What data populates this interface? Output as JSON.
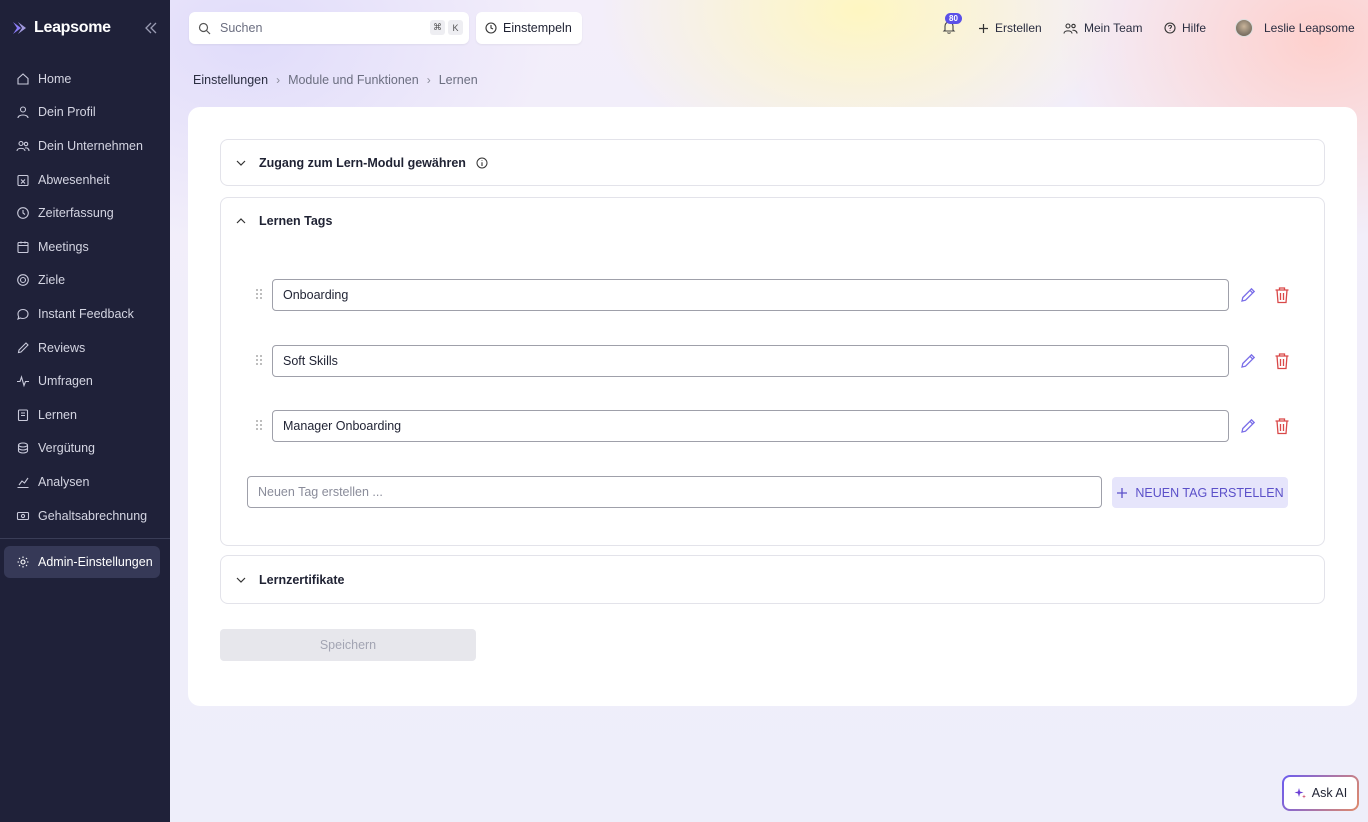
{
  "app": {
    "name": "Leapsome"
  },
  "sidebar": {
    "items": [
      {
        "label": "Home",
        "icon": "home-icon"
      },
      {
        "label": "Dein Profil",
        "icon": "user-icon"
      },
      {
        "label": "Dein Unternehmen",
        "icon": "users-icon"
      },
      {
        "label": "Abwesenheit",
        "icon": "calendar-x-icon"
      },
      {
        "label": "Zeiterfassung",
        "icon": "clock-icon"
      },
      {
        "label": "Meetings",
        "icon": "calendar-icon"
      },
      {
        "label": "Ziele",
        "icon": "target-icon"
      },
      {
        "label": "Instant Feedback",
        "icon": "chat-icon"
      },
      {
        "label": "Reviews",
        "icon": "pencil-icon"
      },
      {
        "label": "Umfragen",
        "icon": "pulse-icon"
      },
      {
        "label": "Lernen",
        "icon": "book-icon"
      },
      {
        "label": "Vergütung",
        "icon": "coins-icon"
      },
      {
        "label": "Analysen",
        "icon": "chart-icon"
      },
      {
        "label": "Gehaltsabrechnung",
        "icon": "money-icon"
      }
    ],
    "admin": {
      "label": "Admin-Einstellungen",
      "icon": "gear-icon"
    }
  },
  "topbar": {
    "search_placeholder": "Suchen",
    "shortcut_cmd": "⌘",
    "shortcut_key": "K",
    "clock_in": "Einstempeln",
    "notifications_count": "80",
    "create": "Erstellen",
    "my_team": "Mein Team",
    "help": "Hilfe",
    "user_name": "Leslie Leapsome"
  },
  "breadcrumb": [
    "Einstellungen",
    "Module und Funktionen",
    "Lernen"
  ],
  "sections": {
    "access": {
      "title": "Zugang zum Lern-Modul gewähren"
    },
    "tags": {
      "title": "Lernen Tags",
      "items": [
        "Onboarding",
        "Soft Skills",
        "Manager Onboarding"
      ],
      "new_placeholder": "Neuen Tag erstellen ...",
      "new_button": "NEUEN TAG ERSTELLEN"
    },
    "certificates": {
      "title": "Lernzertifikate"
    }
  },
  "save_label": "Speichern",
  "ask_ai": "Ask AI",
  "colors": {
    "sidebar_bg": "#1f2139",
    "accent": "#5b50e8",
    "danger": "#d94848",
    "edit": "#7a6ee8"
  }
}
